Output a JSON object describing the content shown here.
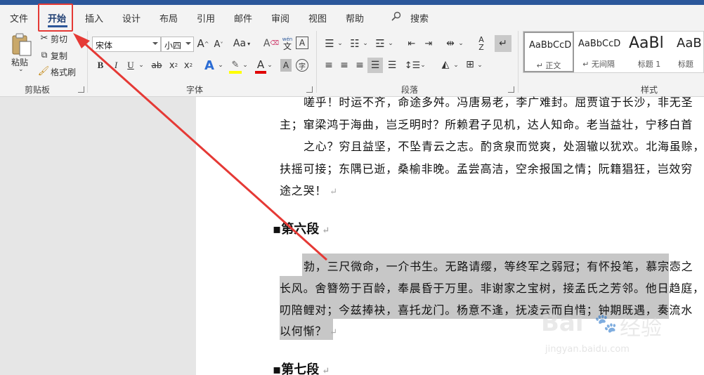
{
  "tabs": [
    "文件",
    "开始",
    "插入",
    "设计",
    "布局",
    "引用",
    "邮件",
    "审阅",
    "视图",
    "帮助"
  ],
  "active_tab": "开始",
  "search_label": "搜索",
  "clipboard": {
    "paste": "粘贴",
    "cut": "剪切",
    "copy": "复制",
    "format_painter": "格式刷",
    "group_label": "剪贴板"
  },
  "font": {
    "name": "宋体",
    "size": "小四",
    "group_label": "字体",
    "case_label": "Aa",
    "phonetic_top": "wén",
    "phonetic_char": "文",
    "bold": "B",
    "italic": "I",
    "underline": "U",
    "strike": "ab",
    "subscript": "x",
    "superscript": "x",
    "text_effect": "A",
    "font_color": "A",
    "char_shade": "A",
    "highlight_color": "#ffff00",
    "font_color_value": "#e00000"
  },
  "paragraph": {
    "group_label": "段落"
  },
  "styles": {
    "group_label": "样式",
    "items": [
      {
        "sample": "AaBbCcD",
        "name": "↵ 正文"
      },
      {
        "sample": "AaBbCcD",
        "name": "↵ 无间隔"
      },
      {
        "sample": "AaBl",
        "name": "标题 1"
      },
      {
        "sample": "AaB",
        "name": "标题"
      }
    ]
  },
  "document": {
    "lines_top": [
      "嗟乎！时运不齐，命途多舛。冯唐易老，李广难封。屈贾谊于长沙，非无圣",
      "主；窜梁鸿于海曲，岂乏明时？所赖君子见机，达人知命。老当益壮，宁移白首",
      "之心？穷且益坚，不坠青云之志。酌贪泉而觉爽，处涸辙以犹欢。北海虽赊，",
      "扶摇可接；东隅已逝，桑榆非晚。孟尝高洁，空余报国之情；阮籍猖狂，岂效穷",
      "途之哭！"
    ],
    "heading6": "第六段",
    "lines_sel": [
      "勃，三尺微命，一介书生。无路请缨，等终军之弱冠；有怀投笔，慕宗悫之",
      "长风。舍簪笏于百龄，奉晨昏于万里。非谢家之宝树，接孟氏之芳邻。他日趋庭，",
      "叨陪鲤对；今兹捧袂，喜托龙门。杨意不逢，抚凌云而自惜；钟期既遇，奏流水",
      "以何惭？"
    ],
    "heading7": "第七段",
    "para_mark": "↵"
  },
  "watermark": {
    "brand": "Bai",
    "brand2": "经验",
    "url": "jingyan.baidu.com"
  },
  "colors": {
    "accent": "#2b579a",
    "annotation": "#e53935",
    "selection": "#c7c7c7"
  }
}
